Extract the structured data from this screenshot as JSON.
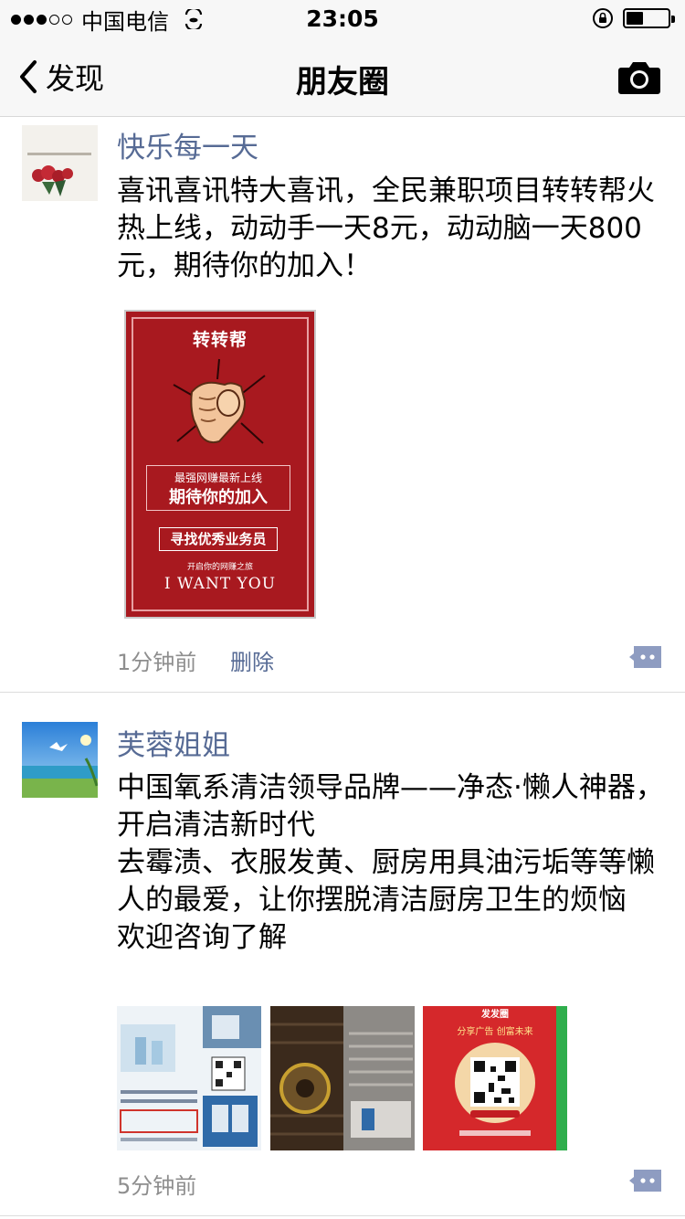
{
  "status_bar": {
    "carrier": "中国电信",
    "time": "23:05",
    "signal_bars_filled": 3,
    "signal_bars_total": 5,
    "battery_level": 0.4
  },
  "nav": {
    "back_label": "发现",
    "title": "朋友圈"
  },
  "posts": [
    {
      "name": "快乐每一天",
      "text": "喜讯喜讯特大喜讯，全民兼职项目转转帮火热上线，动动手一天8元，动动脑一天800元，期待你的加入！",
      "time": "1分钟前",
      "delete_label": "删除",
      "image": {
        "title": "转转帮",
        "line1": "最强网赚最新上线",
        "line2": "期待你的加入",
        "recruit": "寻找优秀业务员",
        "sub": "开启你的网赚之旅",
        "slogan": "I WANT YOU"
      }
    },
    {
      "name": "芙蓉姐姐",
      "text": "中国氧系清洁领导品牌——净态·懒人神器，开启清洁新时代\n去霉渍、衣服发黄、厨房用具油污垢等等懒人的最爱，让你摆脱清洁厨房卫生的烦恼\n欢迎咨询了解",
      "time": "5分钟前",
      "thumbs": [
        {
          "label": "product-flyer"
        },
        {
          "label": "kitchen-grease"
        },
        {
          "label": "qr-ad",
          "title": "发发圈",
          "sub": "分享广告 创富未来"
        }
      ]
    }
  ],
  "colors": {
    "link": "#576b95",
    "poster_red": "#a8191f",
    "comment_icon": "#8e9cc1"
  }
}
